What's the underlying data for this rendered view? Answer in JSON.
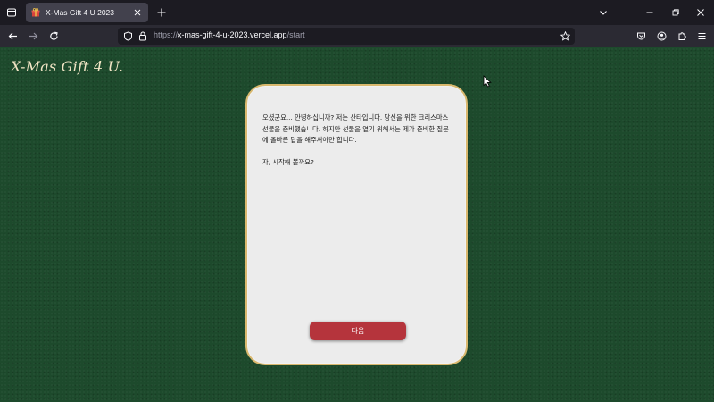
{
  "browser": {
    "tab": {
      "title": "X-Mas Gift 4 U 2023",
      "favicon": "gift-icon"
    },
    "url": {
      "scheme": "https://",
      "host": "x-mas-gift-4-u-2023.vercel.app",
      "path": "/start"
    }
  },
  "page": {
    "logo": "X-Mas Gift 4 U.",
    "card": {
      "paragraph1": "오셨군요... 안녕하십니까? 저는 산타입니다. 당신을 위한 크리스마스 선물을 준비했습니다. 하지만 선물을 열기 위해서는 제가 준비한 질문에 올바른 답을 해주셔야만 합니다.",
      "paragraph2": "자, 시작해 볼까요?",
      "next_button": "다음"
    }
  },
  "colors": {
    "background": "#1d4a2c",
    "card": "#ececec",
    "card_border": "#d9b86e",
    "button": "#b5343c"
  }
}
